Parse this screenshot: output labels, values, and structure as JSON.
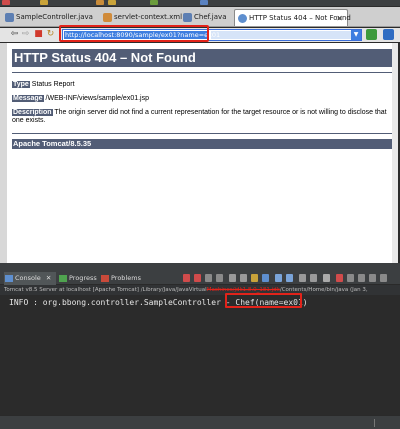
{
  "tabs": [
    {
      "label": "SampleController.java",
      "icon": "java-file-icon",
      "active": false
    },
    {
      "label": "servlet-context.xml",
      "icon": "xml-file-icon",
      "active": false
    },
    {
      "label": "Chef.java",
      "icon": "java-file-icon",
      "active": false
    },
    {
      "label": "HTTP Status 404 – Not Found",
      "icon": "globe-icon",
      "active": true,
      "close": "✕"
    }
  ],
  "toolbar": {
    "back": "⇦",
    "forward": "⇨",
    "stop": "■",
    "refresh": "↻",
    "url": "http://localhost:8090/sample/ex01?name=ex01",
    "dropdown": "▼"
  },
  "page": {
    "title": "HTTP Status 404 – Not Found",
    "type_label": "Type",
    "type_value": "Status Report",
    "message_label": "Message",
    "message_value": "/WEB-INF/views/sample/ex01.jsp",
    "description_label": "Description",
    "description_value": "The origin server did not find a current representation for the target resource or is not willing to disclose that one exists.",
    "server": "Apache Tomcat/8.5.35"
  },
  "console": {
    "tabs": [
      {
        "label": "Console",
        "icon": "console-icon",
        "close": "✕"
      },
      {
        "label": "Progress",
        "icon": "progress-icon"
      },
      {
        "label": "Problems",
        "icon": "problems-icon"
      }
    ],
    "header_prefix": "Tomcat v8.5 Server at localhost [Apache Tomcat] /Library/Java/JavaVirtual",
    "header_strike": "Machines/jdk1.8.0_181.jdk",
    "header_suffix": "/Contents/Home/bin/java (Jan 3,",
    "log_prefix": "INFO : org.bbong.controller.SampleController - ",
    "log_value": "Chef(name=ex01)"
  },
  "colors": {
    "tomcat_header": "#525d76",
    "highlight_red": "#e2231a",
    "url_selection": "#3d7ee0"
  }
}
